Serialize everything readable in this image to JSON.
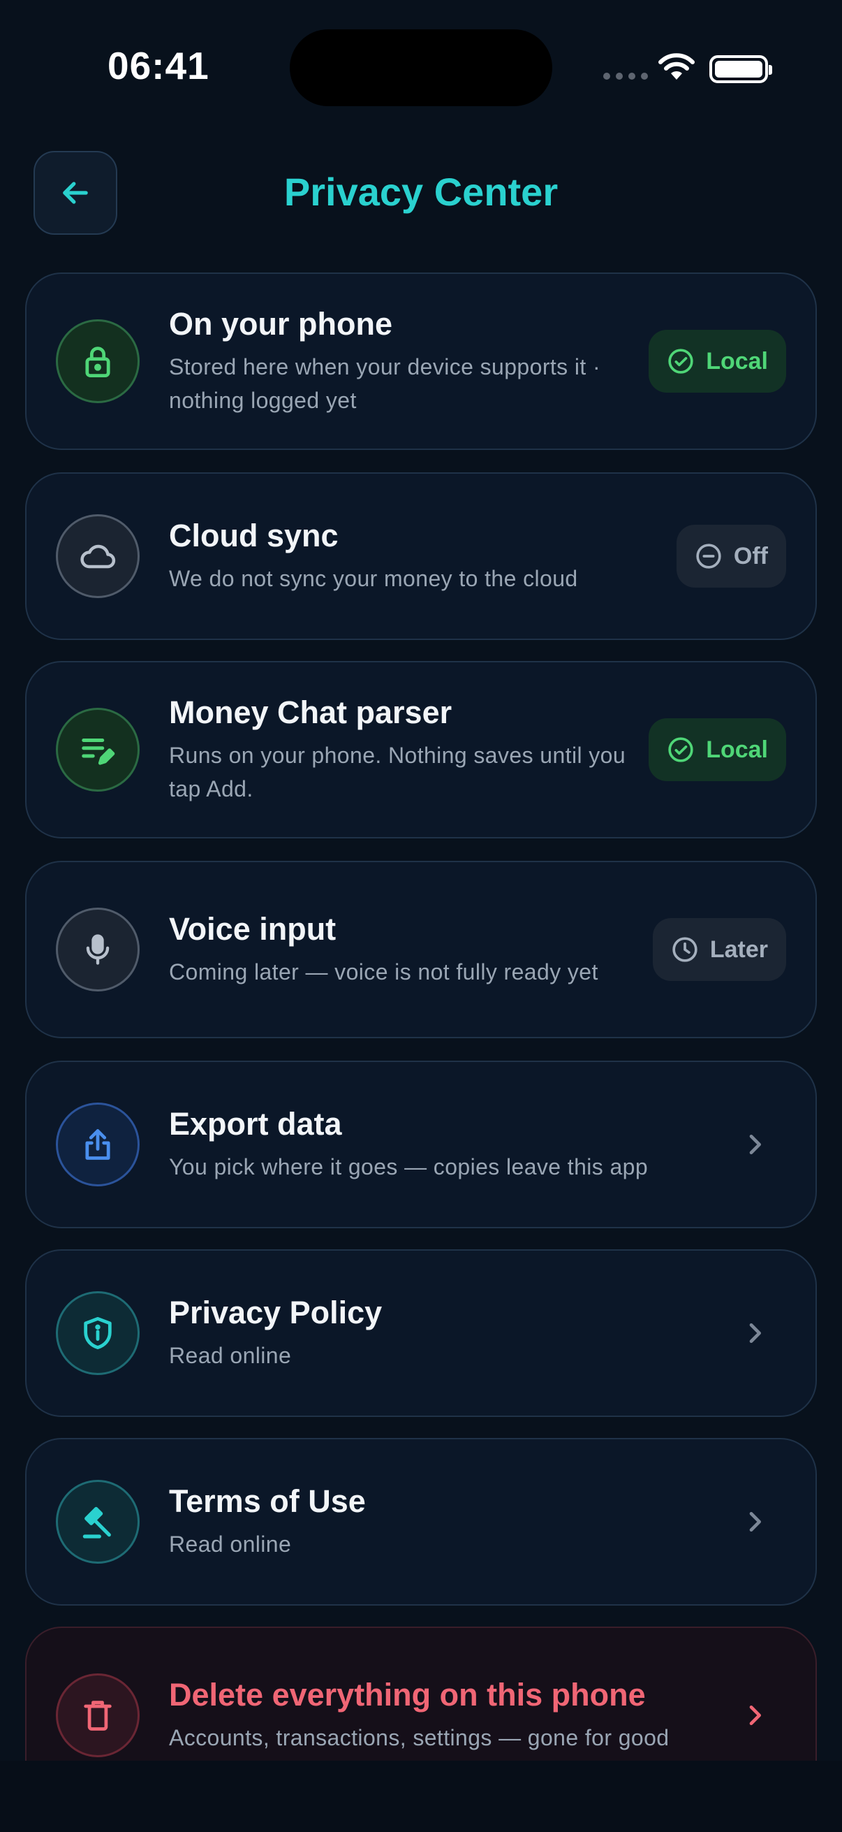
{
  "status_bar": {
    "time": "06:41"
  },
  "header": {
    "title": "Privacy Center",
    "back_icon": "arrow-left-icon"
  },
  "colors": {
    "accent": "#2ad1cf",
    "local_green": "#4fd677",
    "danger_red": "#f06675",
    "background": "#08111c",
    "card": "#0b1728"
  },
  "cards": [
    {
      "title": "On your phone",
      "subtitle": "Stored here when your device supports it · nothing logged yet",
      "icon": "lock-icon",
      "badge": "Local"
    },
    {
      "title": "Cloud sync",
      "subtitle": "We do not sync your money to the cloud",
      "icon": "cloud-icon",
      "badge": "Off"
    },
    {
      "title": "Money Chat parser",
      "subtitle": "Runs on your phone. Nothing saves until you tap Add.",
      "icon": "edit-notes-icon",
      "badge": "Local"
    },
    {
      "title": "Voice input",
      "subtitle": "Coming later — voice is not fully ready yet",
      "icon": "microphone-icon",
      "badge": "Later"
    },
    {
      "title": "Export data",
      "subtitle": "You pick where it goes — copies leave this app",
      "icon": "share-export-icon"
    },
    {
      "title": "Privacy Policy",
      "subtitle": "Read online",
      "icon": "shield-info-icon"
    },
    {
      "title": "Terms of Use",
      "subtitle": "Read online",
      "icon": "gavel-icon"
    },
    {
      "title": "Delete everything on this phone",
      "subtitle": "Accounts, transactions, settings — gone for good",
      "icon": "trash-icon"
    }
  ]
}
